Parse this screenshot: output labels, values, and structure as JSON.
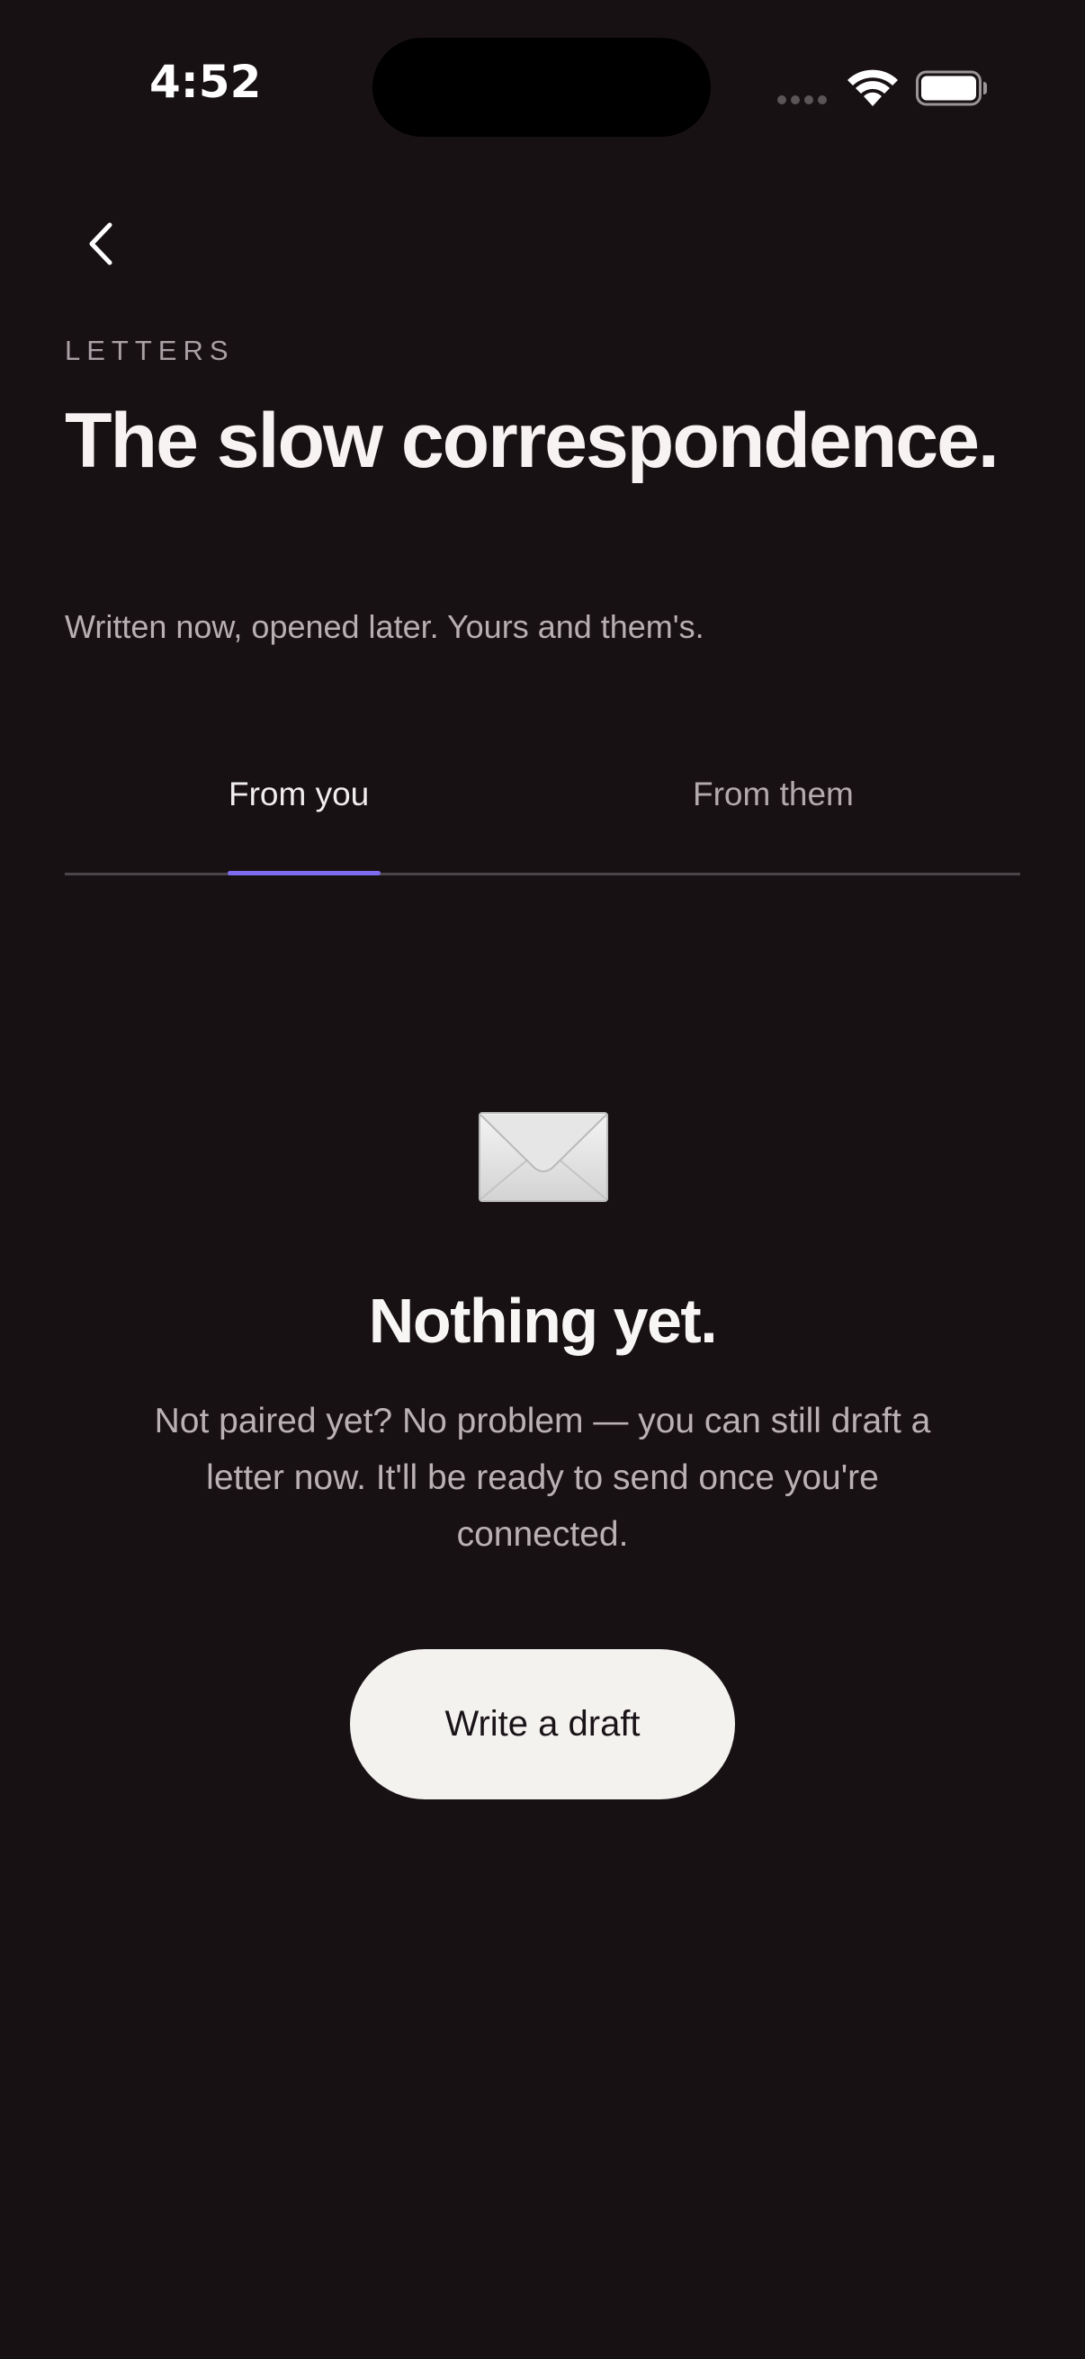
{
  "status_bar": {
    "time": "4:52"
  },
  "header": {
    "eyebrow": "LETTERS",
    "title": "The slow correspondence.",
    "subtitle": "Written now, opened later. Yours and them's."
  },
  "tabs": [
    {
      "label": "From you",
      "active": true
    },
    {
      "label": "From them",
      "active": false
    }
  ],
  "empty_state": {
    "icon": "envelope-icon",
    "title": "Nothing yet.",
    "body": "Not paired yet? No problem — you can still draft a letter now. It'll be ready to send once you're connected.",
    "button_label": "Write a draft"
  },
  "colors": {
    "background": "#181114",
    "accent": "#7d6cf0",
    "button_bg": "#f3f2ef"
  }
}
